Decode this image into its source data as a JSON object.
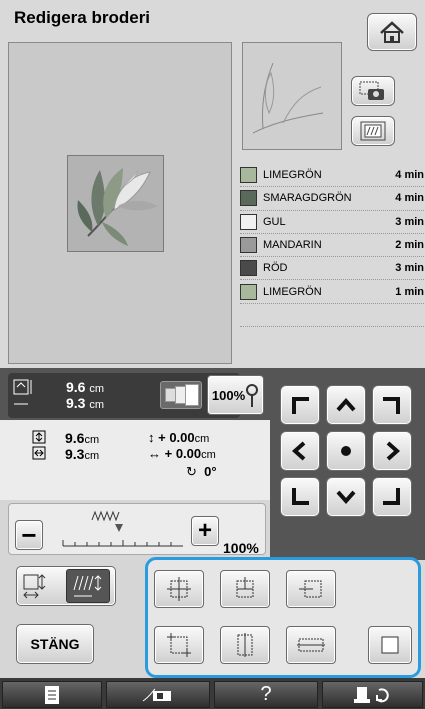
{
  "header": {
    "title": "Redigera broderi"
  },
  "threads": [
    {
      "name": "LIMEGRÖN",
      "time": "4 min",
      "color": "#a8b89c"
    },
    {
      "name": "SMARAGDGRÖN",
      "time": "4 min",
      "color": "#5a6a5a"
    },
    {
      "name": "GUL",
      "time": "3 min",
      "color": "#f0f0f0"
    },
    {
      "name": "MANDARIN",
      "time": "2 min",
      "color": "#9a9a9a"
    },
    {
      "name": "RÖD",
      "time": "3 min",
      "color": "#4a4a4a"
    },
    {
      "name": "LIMEGRÖN",
      "time": "1 min",
      "color": "#a8b89c"
    }
  ],
  "info": {
    "height": "9.6",
    "width": "9.3",
    "unit": "cm",
    "zoom": "100%"
  },
  "position": {
    "height": "9.6",
    "width": "9.3",
    "unit": "cm",
    "vert_offset": "+ 0.00",
    "horiz_offset": "+ 0.00",
    "rotation": "0°"
  },
  "density": {
    "label": "100%"
  },
  "buttons": {
    "close": "STÄNG"
  }
}
